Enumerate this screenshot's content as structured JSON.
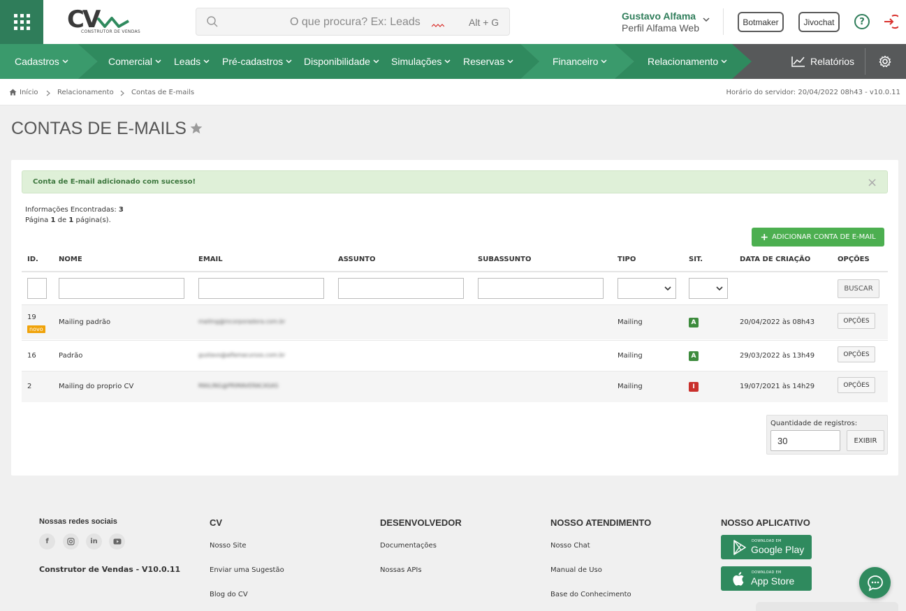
{
  "header": {
    "logo_text": "CV",
    "logo_subtitle": "CONSTRUTOR DE VENDAS",
    "search_placeholder": "O que procura? Ex: Leads",
    "search_shortcut": "Alt + G",
    "user_name": "Gustavo Alfama",
    "user_profile": "Perfil Alfama Web",
    "botmaker_label": "Botmaker",
    "jivochat_label": "Jivochat",
    "help_label": "?",
    "accent_color": "#2f7d5a"
  },
  "nav": {
    "items": [
      {
        "label": "Cadastros"
      },
      {
        "label": "Comercial"
      },
      {
        "label": "Leads"
      },
      {
        "label": "Pré-cadastros"
      },
      {
        "label": "Disponibilidade"
      },
      {
        "label": "Simulações"
      },
      {
        "label": "Reservas"
      },
      {
        "label": "Financeiro"
      },
      {
        "label": "Relacionamento"
      }
    ],
    "reports_label": "Relatórios"
  },
  "breadcrumb": {
    "items": [
      "Início",
      "Relacionamento",
      "Contas de E-mails"
    ],
    "server_time": "Horário do servidor: 20/04/2022 08h43 - v10.0.11"
  },
  "page": {
    "title": "CONTAS DE E-MAILS"
  },
  "alert": {
    "message": "Conta de E-mail adicionado com sucesso!",
    "close": "×"
  },
  "summary": {
    "found_label": "Informações Encontradas:",
    "found_count": "3",
    "page_prefix": "Página",
    "page_current": "1",
    "page_of": "de",
    "page_total": "1",
    "page_suffix": "página(s)."
  },
  "add_button_label": "ADICIONAR CONTA DE E-MAIL",
  "table": {
    "columns": [
      "ID.",
      "NOME",
      "EMAIL",
      "ASSUNTO",
      "SUBASSUNTO",
      "TIPO",
      "SIT.",
      "DATA DE CRIAÇÃO",
      "OPÇÕES"
    ],
    "search_label": "BUSCAR",
    "rows": [
      {
        "id": "19",
        "badge": "novo",
        "name": "Mailing padrão",
        "email": "mailing@incorporadora.com.br",
        "subject": "",
        "subsubject": "",
        "type": "Mailing",
        "status": "A",
        "created": "20/04/2022 às 08h43",
        "options": "OPÇÕES"
      },
      {
        "id": "16",
        "badge": "",
        "name": "Padrão",
        "email": "gustavo@alfamacursos.com.br",
        "subject": "",
        "subsubject": "",
        "type": "Mailing",
        "status": "A",
        "created": "29/03/2022 às 13h49",
        "options": "OPÇÕES"
      },
      {
        "id": "2",
        "badge": "",
        "name": "Mailing do proprio CV",
        "email": "MAILING@PRIMAVERACASAS",
        "subject": "",
        "subsubject": "",
        "type": "Mailing",
        "status": "I",
        "created": "19/07/2021 às 14h29",
        "options": "OPÇÕES"
      }
    ]
  },
  "pagination": {
    "qty_label": "Quantidade de registros:",
    "qty_value": "30",
    "show_label": "EXIBIR"
  },
  "footer": {
    "social_title": "Nossas redes sociais",
    "social": [
      "f",
      "instagram",
      "in",
      "youtube"
    ],
    "version": "Construtor de Vendas - V10.0.11",
    "cv": {
      "title": "CV",
      "links": [
        "Nosso Site",
        "Enviar uma Sugestão",
        "Blog do CV"
      ]
    },
    "dev": {
      "title": "DESENVOLVEDOR",
      "links": [
        "Documentações",
        "Nossas APIs"
      ]
    },
    "support": {
      "title": "NOSSO ATENDIMENTO",
      "links": [
        "Nosso Chat",
        "Manual de Uso",
        "Base do Conhecimento"
      ]
    },
    "app": {
      "title": "NOSSO APLICATIVO",
      "google_small": "DOWNLOAD EM",
      "google_big": "Google Play",
      "apple_small": "DOWNLOAD EM",
      "apple_big": "App Store"
    }
  }
}
